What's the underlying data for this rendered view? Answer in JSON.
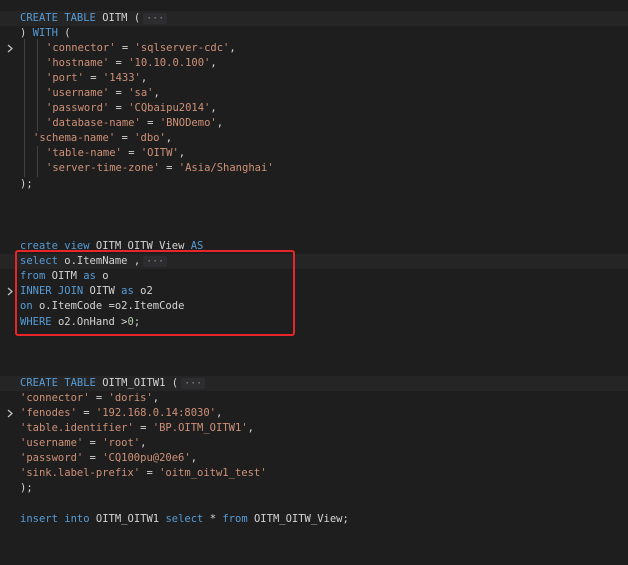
{
  "block1": {
    "l1": {
      "kw1": "CREATE",
      "kw2": "TABLE",
      "name": "OITM",
      "paren": "(",
      "fold": "···"
    },
    "l2": {
      "paren": ")",
      "kw": "WITH",
      "open": "("
    },
    "props": [
      {
        "key": "'connector'",
        "eq": "=",
        "val": "'sqlserver-cdc'",
        "comma": ","
      },
      {
        "key": "'hostname'",
        "eq": "=",
        "val": "'10.10.0.100'",
        "comma": ","
      },
      {
        "key": "'port'",
        "eq": "=",
        "val": "'1433'",
        "comma": ","
      },
      {
        "key": "'username'",
        "eq": "=",
        "val": "'sa'",
        "comma": ","
      },
      {
        "key": "'password'",
        "eq": "=",
        "val": "'CQbaipu2014'",
        "comma": ","
      },
      {
        "key": "'database-name'",
        "eq": "=",
        "val": "'BNODemo'",
        "comma": ","
      }
    ],
    "schema": {
      "key": "'schema-name'",
      "eq": "=",
      "val": "'dbo'",
      "comma": ","
    },
    "props2": [
      {
        "key": "'table-name'",
        "eq": "=",
        "val": "'OITW'",
        "comma": ","
      },
      {
        "key": "'server-time-zone'",
        "eq": "=",
        "val": "'Asia/Shanghai'",
        "comma": ""
      }
    ],
    "end": ");"
  },
  "block2": {
    "create": {
      "kw1": "create",
      "kw2": "view",
      "name": "OITM_OITW_View",
      "kw3": "AS"
    },
    "select": {
      "kw": "select",
      "expr": "o.ItemName",
      "comma": ",",
      "fold": "···"
    },
    "from": {
      "kw": "from",
      "table": "OITM",
      "kw2": "as",
      "alias": "o"
    },
    "join": {
      "kw": "INNER JOIN",
      "table": "OITW",
      "kw2": "as",
      "alias": "o2"
    },
    "on": {
      "kw": "on",
      "left": "o.ItemCode",
      "op": "=",
      "right": "o2.ItemCode"
    },
    "where": {
      "kw": "WHERE",
      "left": "o2.OnHand",
      "op": ">",
      "num": "0",
      "end": ";"
    }
  },
  "block3": {
    "l1": {
      "kw1": "CREATE",
      "kw2": "TABLE",
      "name": "OITM_OITW1",
      "paren": "(",
      "fold": "···"
    },
    "props": [
      {
        "key": "'connector'",
        "eq": "=",
        "val": "'doris'",
        "comma": ","
      },
      {
        "key": "'fenodes'",
        "eq": "=",
        "val": "'192.168.0.14:8030'",
        "comma": ","
      },
      {
        "key": "'table.identifier'",
        "eq": "=",
        "val": "'BP.OITM_OITW1'",
        "comma": ","
      },
      {
        "key": "'username'",
        "eq": "=",
        "val": "'root'",
        "comma": ","
      },
      {
        "key": "'password'",
        "eq": "=",
        "val": "'CQ100pu@20e6'",
        "comma": ","
      },
      {
        "key": "'sink.label-prefix'",
        "eq": "=",
        "val": "'oitm_oitw1_test'",
        "comma": ""
      }
    ],
    "end": ");"
  },
  "insert": {
    "kw1": "insert",
    "kw2": "into",
    "target": "OITM_OITW1",
    "kw3": "select",
    "star": "*",
    "kw4": "from",
    "source": "OITM_OITW_View",
    "end": ";"
  },
  "colors": {
    "keyword": "#569cd6",
    "string": "#ce9178",
    "number": "#b5cea8",
    "text": "#d4d4d4",
    "background": "#1e1e1e",
    "highlight": "#e8262a"
  }
}
